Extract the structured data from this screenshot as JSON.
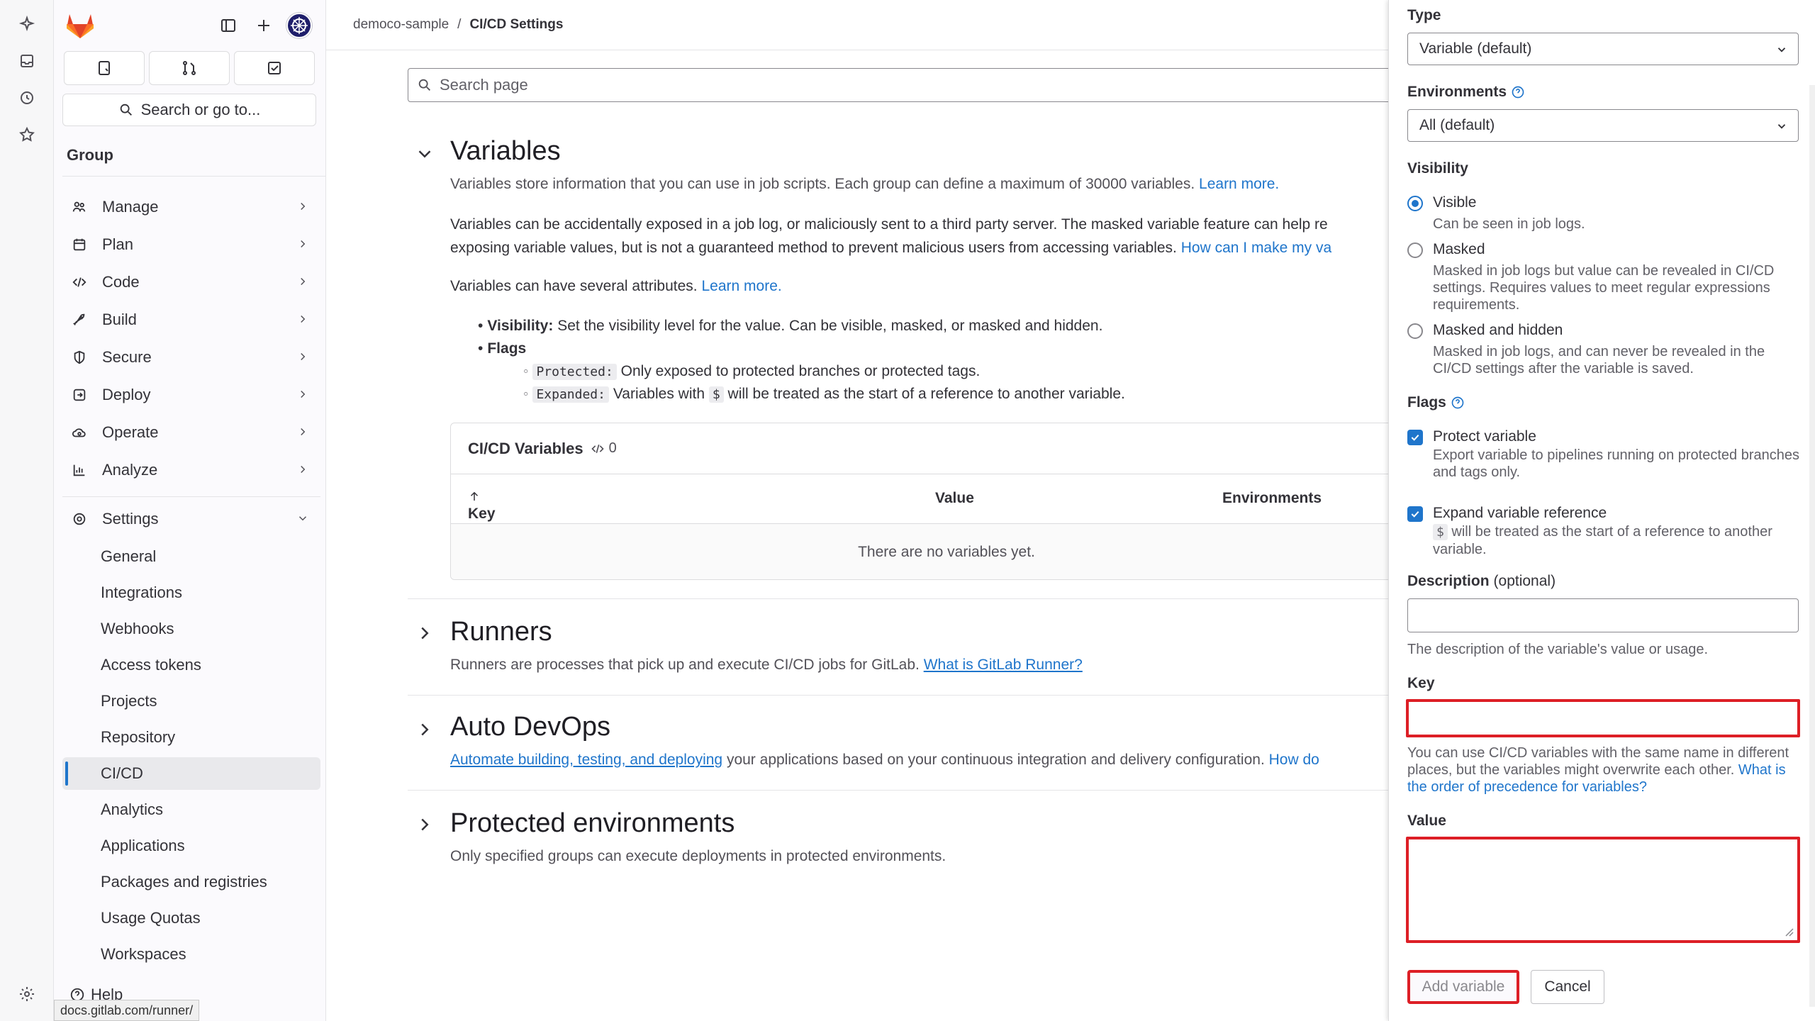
{
  "breadcrumb": {
    "parent": "democo-sample",
    "separator": "/",
    "current": "CI/CD Settings"
  },
  "sidebar": {
    "search_label": "Search or go to...",
    "group_label": "Group",
    "nav": [
      {
        "label": "Manage",
        "icon": "users-icon"
      },
      {
        "label": "Plan",
        "icon": "calendar-icon"
      },
      {
        "label": "Code",
        "icon": "code-icon"
      },
      {
        "label": "Build",
        "icon": "rocket-icon"
      },
      {
        "label": "Secure",
        "icon": "shield-icon"
      },
      {
        "label": "Deploy",
        "icon": "deploy-icon"
      },
      {
        "label": "Operate",
        "icon": "cloud-gear-icon"
      },
      {
        "label": "Analyze",
        "icon": "chart-icon"
      }
    ],
    "settings_label": "Settings",
    "settings_items": [
      "General",
      "Integrations",
      "Webhooks",
      "Access tokens",
      "Projects",
      "Repository",
      "CI/CD",
      "Analytics",
      "Applications",
      "Packages and registries",
      "Usage Quotas",
      "Workspaces"
    ],
    "active_item": "CI/CD",
    "help_label": "Help"
  },
  "status_url": "docs.gitlab.com/runner/",
  "search_page_placeholder": "Search page",
  "variables": {
    "title": "Variables",
    "desc": "Variables store information that you can use in job scripts. Each group can define a maximum of 30000 variables.",
    "desc_link": "Learn more.",
    "warning_line1": "Variables can be accidentally exposed in a job log, or maliciously sent to a third party server. The masked variable feature can help re",
    "warning_line2": "exposing variable values, but is not a guaranteed method to prevent malicious users from accessing variables.",
    "warning_link": "How can I make my va",
    "attrs_text": "Variables can have several attributes.",
    "attrs_link": "Learn more.",
    "bullet_visibility_label": "Visibility:",
    "bullet_visibility_text": "Set the visibility level for the value. Can be visible, masked, or masked and hidden.",
    "bullet_flags": "Flags",
    "flag_protected_code": "Protected:",
    "flag_protected_text": "Only exposed to protected branches or protected tags.",
    "flag_expanded_code": "Expanded:",
    "flag_expanded_pre": "Variables with",
    "flag_expanded_dollar": "$",
    "flag_expanded_post": "will be treated as the start of a reference to another variable.",
    "card_title": "CI/CD Variables",
    "card_count": "0",
    "col_key": "Key",
    "col_value": "Value",
    "col_env": "Environments",
    "empty": "There are no variables yet."
  },
  "runners": {
    "title": "Runners",
    "desc": "Runners are processes that pick up and execute CI/CD jobs for GitLab.",
    "link": "What is GitLab Runner?"
  },
  "autodevops": {
    "title": "Auto DevOps",
    "link": "Automate building, testing, and deploying",
    "desc": "your applications based on your continuous integration and delivery configuration.",
    "link2": "How do"
  },
  "protected_envs": {
    "title": "Protected environments",
    "desc": "Only specified groups can execute deployments in protected environments."
  },
  "drawer": {
    "type_label": "Type",
    "type_value": "Variable (default)",
    "env_label": "Environments",
    "env_value": "All (default)",
    "visibility_label": "Visibility",
    "visibility_options": [
      {
        "title": "Visible",
        "help": "Can be seen in job logs.",
        "checked": true
      },
      {
        "title": "Masked",
        "help": "Masked in job logs but value can be revealed in CI/CD settings. Requires values to meet regular expressions requirements.",
        "checked": false
      },
      {
        "title": "Masked and hidden",
        "help": "Masked in job logs, and can never be revealed in the CI/CD settings after the variable is saved.",
        "checked": false
      }
    ],
    "flags_label": "Flags",
    "flag_protect_title": "Protect variable",
    "flag_protect_help": "Export variable to pipelines running on protected branches and tags only.",
    "flag_expand_title": "Expand variable reference",
    "flag_expand_dollar": "$",
    "flag_expand_help": "will be treated as the start of a reference to another variable.",
    "desc_label": "Description",
    "desc_optional": "(optional)",
    "desc_help": "The description of the variable's value or usage.",
    "key_label": "Key",
    "key_help": "You can use CI/CD variables with the same name in different places, but the variables might overwrite each other.",
    "key_help_link": "What is the order of precedence for variables?",
    "value_label": "Value",
    "add_button": "Add variable",
    "cancel_button": "Cancel"
  },
  "colors": {
    "accent": "#1f75cb",
    "error": "#dd1f26",
    "text": "#333238"
  }
}
